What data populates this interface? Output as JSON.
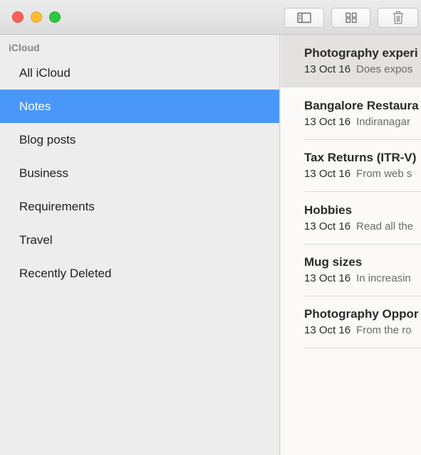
{
  "toolbar": {
    "icons": {
      "sidebar_toggle": "sidebar-toggle-icon",
      "attachments": "grid-icon",
      "delete": "trash-icon"
    }
  },
  "colors": {
    "selection_blue": "#4a97fa",
    "close": "#fc5f57",
    "minimize": "#fdbc2e",
    "zoom": "#28c840"
  },
  "sidebar": {
    "header": "iCloud",
    "items": [
      {
        "label": "All iCloud"
      },
      {
        "label": "Notes",
        "selected": true
      },
      {
        "label": "Blog posts"
      },
      {
        "label": "Business"
      },
      {
        "label": "Requirements"
      },
      {
        "label": "Travel"
      },
      {
        "label": "Recently Deleted"
      }
    ]
  },
  "notes": [
    {
      "title": "Photography experi",
      "date": "13 Oct 16",
      "preview": "Does expos",
      "selected": true
    },
    {
      "title": "Bangalore Restaura",
      "date": "13 Oct 16",
      "preview": "Indiranagar"
    },
    {
      "title": "Tax Returns (ITR-V)",
      "date": "13 Oct 16",
      "preview": "From web s"
    },
    {
      "title": "Hobbies",
      "date": "13 Oct 16",
      "preview": "Read all the"
    },
    {
      "title": "Mug sizes",
      "date": "13 Oct 16",
      "preview": "In increasin"
    },
    {
      "title": "Photography Oppor",
      "date": "13 Oct 16",
      "preview": "From the ro"
    }
  ]
}
